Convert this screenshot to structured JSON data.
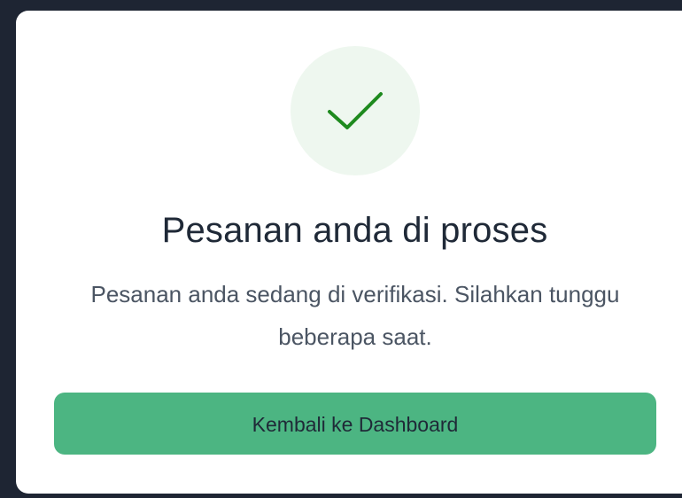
{
  "dialog": {
    "title": "Pesanan anda di proses",
    "message": "Pesanan anda sedang di verifikasi. Silahkan tunggu beberapa saat.",
    "button_label": "Kembali ke Dashboard",
    "success_icon": "check-icon"
  },
  "colors": {
    "accent": "#4cb582",
    "check": "#1e8a1e",
    "icon_bg": "#eef7ef"
  }
}
